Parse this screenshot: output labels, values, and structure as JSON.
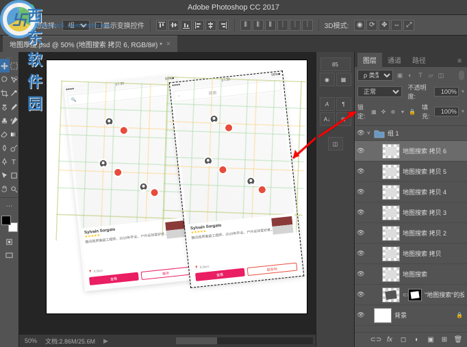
{
  "app": {
    "title": "Adobe Photoshop CC 2017"
  },
  "watermark": {
    "text": "西东软件园",
    "url": "www.pc6.com/softview",
    "logo_letter": "卐"
  },
  "options": {
    "auto_select_label": "自动选择:",
    "auto_select_value": "组",
    "show_transform": "显示变换控件",
    "mode_3d": "3D模式:"
  },
  "document": {
    "tab_title": "地图厚度.psd @ 50% (地图搜索 拷贝 6, RGB/8#) *",
    "zoom": "50%",
    "doc_info": "文档:2.86M/25.6M"
  },
  "mockup": {
    "search_placeholder": "搜索",
    "card_name": "Sylvain Sorgato",
    "card_rating": "★★★★★",
    "card_desc1": "腾讯视界高级工程师，2010年毕业，户外运动爱好者...",
    "card_desc2": "腾讯视界高级工程师，2010年毕业，户外运动爱好者，2013年...",
    "distance": "8.8km",
    "btn_view": "查看",
    "btn_chat": "聊天",
    "btn_contact": "联系他"
  },
  "layers_panel": {
    "tabs": {
      "layers": "图层",
      "channels": "通道",
      "paths": "路径"
    },
    "kind_label": "类型",
    "blend_mode": "正常",
    "opacity_label": "不透明度:",
    "opacity_value": "100%",
    "lock_label": "锁定:",
    "fill_label": "填充:",
    "fill_value": "100%",
    "group_name": "组 1",
    "layers": [
      {
        "name": "地图搜索 拷贝 6",
        "selected": true
      },
      {
        "name": "地图搜索 拷贝 5"
      },
      {
        "name": "地图搜索 拷贝 4"
      },
      {
        "name": "地图搜索 拷贝 3"
      },
      {
        "name": "地图搜索 拷贝 2"
      },
      {
        "name": "地图搜索 拷贝"
      },
      {
        "name": "地图搜索"
      },
      {
        "name": "\"地图搜索\"的投影",
        "smart": true
      }
    ],
    "background": "背景"
  },
  "right_dock": {
    "tabs": [
      "85",
      "A",
      "¶",
      "A↓",
      "⊞"
    ]
  }
}
